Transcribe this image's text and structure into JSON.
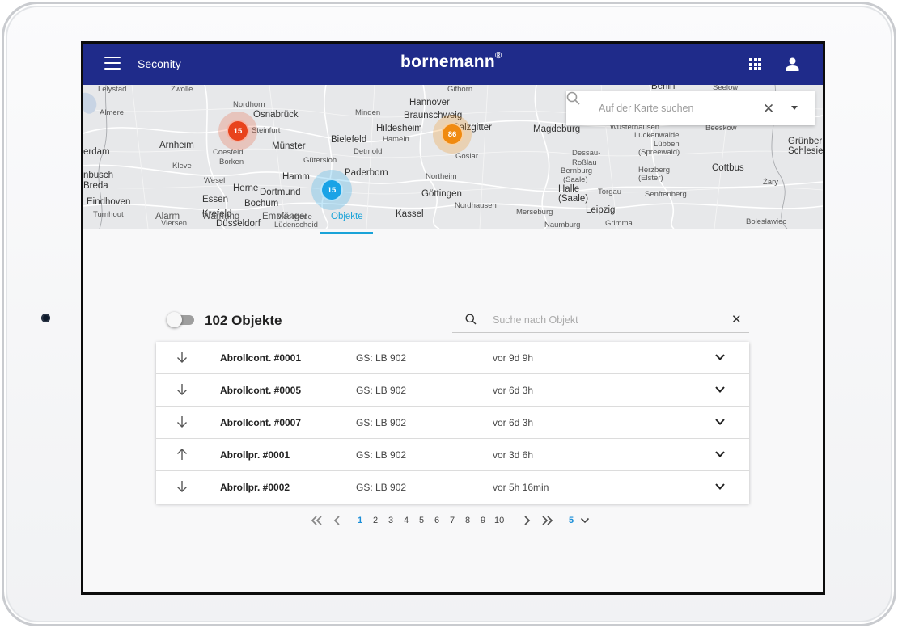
{
  "header": {
    "app_name": "Seconity",
    "brand": "bornemann",
    "brand_mark": "®"
  },
  "map": {
    "search_placeholder": "Auf der Karte suchen",
    "clusters": [
      {
        "count": "15",
        "color": "#e8431c"
      },
      {
        "count": "86",
        "color": "#f08a10"
      },
      {
        "count": "15",
        "color": "#1aa3e6"
      }
    ],
    "labels": {
      "lelystad": "Lelystad",
      "zwolle": "Zwolle",
      "gifhorn": "Gifhorn",
      "berlin": "Berlin",
      "seelow": "Seelow",
      "almere": "Almere",
      "nordhorn": "Nordhorn",
      "osnabrueck": "Osnabrück",
      "minden": "Minden",
      "hannover": "Hannover",
      "braunschweig": "Braunschweig",
      "steinfurt": "Steinfurt",
      "hildesheim": "Hildesheim",
      "hameln": "Hameln",
      "salzgitter": "Salzgitter",
      "magdeburg": "Magdeburg",
      "wusterhausen": "Wusterhausen",
      "luckenwalde": "Luckenwalde",
      "beeskow": "Beeskow",
      "arnheim": "Arnheim",
      "coesfeld": "Coesfeld",
      "muenster": "Münster",
      "bielefeld": "Bielefeld",
      "detmold": "Detmold",
      "goslar": "Goslar",
      "luebben": "Lübben",
      "spreewald": "(Spreewald)",
      "gruenber": "Grünber",
      "schlesie": "Schlesie",
      "erdam": "erdam",
      "borken": "Borken",
      "guetersloh": "Gütersloh",
      "dessau": "Dessau-",
      "rosslau": "Roßlau",
      "kleve": "Kleve",
      "paderborn": "Paderborn",
      "nbusch": "nbusch",
      "wesel": "Wesel",
      "hamm": "Hamm",
      "northeim": "Northeim",
      "bernburg": "Bernburg",
      "saale": "(Saale)",
      "herzberg": "Herzberg",
      "elster": "(Elster)",
      "cottbus": "Cottbus",
      "breda": "Breda",
      "herne": "Herne",
      "dortmund": "Dortmund",
      "halle": "Halle",
      "torgau": "Torgau",
      "senftenberg": "Senftenberg",
      "zary": "Żary",
      "eindhoven": "Eindhoven",
      "essen": "Essen",
      "bochum": "Bochum",
      "goettingen": "Göttingen",
      "saale2": "(Saale)",
      "nordhausen": "Nordhausen",
      "turnhout": "Turnhout",
      "krefeld": "Krefeld",
      "meschede": "Meschede",
      "kassel": "Kassel",
      "merseburg": "Merseburg",
      "leipzig": "Leipzig",
      "viersen": "Viersen",
      "duesseldorf": "Düsseldorf",
      "luedenscheid": "Lüdenscheid",
      "naumburg": "Naumburg",
      "grimma": "Grimma",
      "boleslawiec": "Bolesławiec"
    }
  },
  "tabs": [
    {
      "label": "Alarm"
    },
    {
      "label": "Warnung"
    },
    {
      "label": "Empfänger"
    },
    {
      "label": "Objekte",
      "active": true
    }
  ],
  "objects": {
    "count_label": "102 Objekte",
    "toggle_on": false,
    "search_placeholder": "Suche nach Objekt",
    "rows": [
      {
        "direction": "down",
        "name": "Abrollcont. #0001",
        "group": "GS: LB 902",
        "time": "vor 9d 9h"
      },
      {
        "direction": "down",
        "name": "Abrollcont. #0005",
        "group": "GS: LB 902",
        "time": "vor 6d 3h"
      },
      {
        "direction": "down",
        "name": "Abrollcont. #0007",
        "group": "GS: LB 902",
        "time": "vor 6d 3h"
      },
      {
        "direction": "up",
        "name": "Abrollpr. #0001",
        "group": "GS: LB 902",
        "time": "vor 3d 6h"
      },
      {
        "direction": "down",
        "name": "Abrollpr. #0002",
        "group": "GS: LB 902",
        "time": "vor 5h 16min"
      }
    ]
  },
  "pagination": {
    "pages": [
      "1",
      "2",
      "3",
      "4",
      "5",
      "6",
      "7",
      "8",
      "9",
      "10"
    ],
    "current": "1",
    "page_size": "5"
  },
  "colors": {
    "header_bg": "#1f2b8a",
    "accent": "#1aa3d8"
  }
}
